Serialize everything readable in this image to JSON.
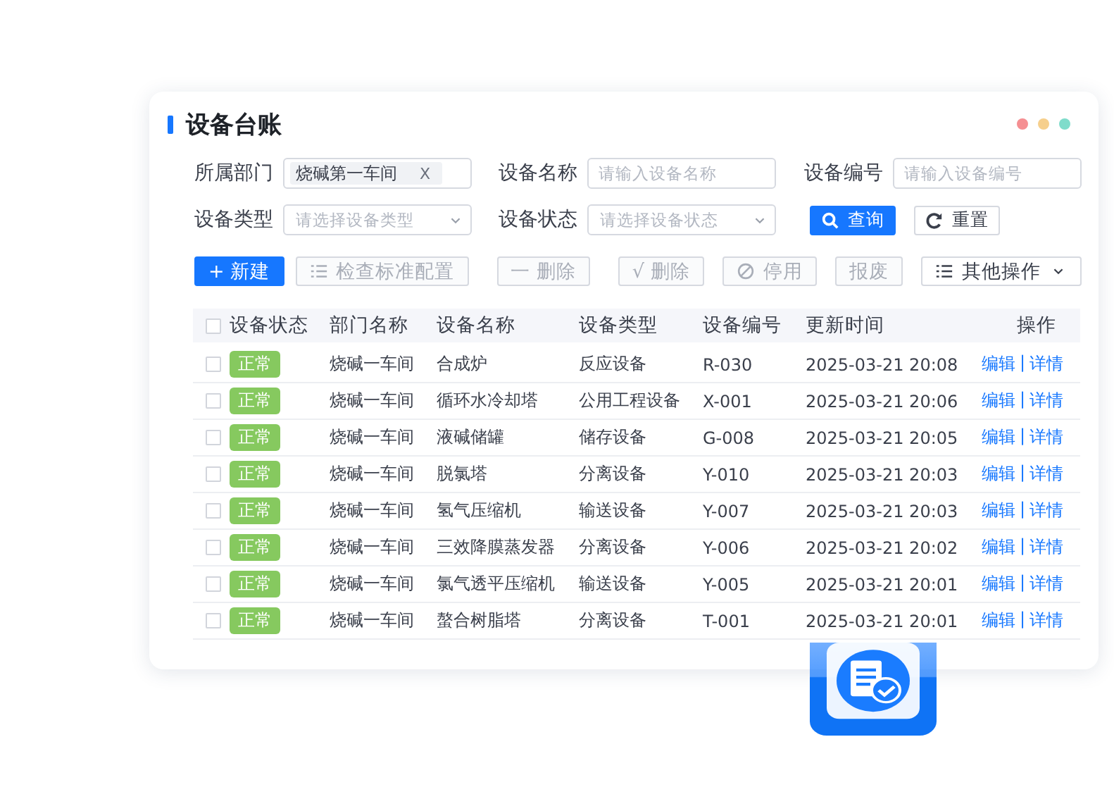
{
  "title": "设备台账",
  "filters": [
    {
      "label": "所属部门",
      "kind": "tag",
      "value": "烧碱第一车间",
      "clear": "X"
    },
    {
      "label": "设备名称",
      "kind": "input",
      "placeholder": "请输入设备名称"
    },
    {
      "label": "设备编号",
      "kind": "input",
      "placeholder": "请输入设备编号"
    },
    {
      "label": "设备类型",
      "kind": "select",
      "placeholder": "请选择设备类型"
    },
    {
      "label": "设备状态",
      "kind": "select",
      "placeholder": "请选择设备状态"
    }
  ],
  "filter_buttons": [
    {
      "label": "查询",
      "kind": "primary"
    },
    {
      "label": "重置",
      "kind": "default"
    }
  ],
  "toolbar": [
    {
      "label": "+ 新建",
      "kind": "primary",
      "disabled": false
    },
    {
      "label": "检查标准配置",
      "kind": "default",
      "disabled": true
    },
    {
      "label": "一 删除",
      "kind": "default",
      "disabled": true
    },
    {
      "label": "√ 删除",
      "kind": "default",
      "disabled": true
    },
    {
      "label": "停用",
      "kind": "default",
      "disabled": true
    },
    {
      "label": "报废",
      "kind": "default",
      "disabled": true
    },
    {
      "label": "其他操作",
      "kind": "menu",
      "disabled": false
    }
  ],
  "table": {
    "header_checked": false,
    "columns": [
      "设备状态",
      "部门名称",
      "设备名称",
      "设备类型",
      "设备编号",
      "更新时间",
      "操作"
    ],
    "rows": [
      {
        "checked": false,
        "status": "正常",
        "dept": "烧碱一车间",
        "name": "合成炉",
        "type": "反应设备",
        "code": "R-030",
        "time": "2025-03-21 20:08",
        "edit": "编辑",
        "sep": "|",
        "detail": "详情"
      },
      {
        "checked": false,
        "status": "正常",
        "dept": "烧碱一车间",
        "name": "循环水冷却塔",
        "type": "公用工程设备",
        "code": "X-001",
        "time": "2025-03-21 20:06",
        "edit": "编辑",
        "sep": "|",
        "detail": "详情"
      },
      {
        "checked": false,
        "status": "正常",
        "dept": "烧碱一车间",
        "name": "液碱储罐",
        "type": "储存设备",
        "code": "G-008",
        "time": "2025-03-21 20:05",
        "edit": "编辑",
        "sep": "|",
        "detail": "详情"
      },
      {
        "checked": false,
        "status": "正常",
        "dept": "烧碱一车间",
        "name": "脱氯塔",
        "type": "分离设备",
        "code": "Y-010",
        "time": "2025-03-21 20:03",
        "edit": "编辑",
        "sep": "|",
        "detail": "详情"
      },
      {
        "checked": false,
        "status": "正常",
        "dept": "烧碱一车间",
        "name": "氢气压缩机",
        "type": "输送设备",
        "code": "Y-007",
        "time": "2025-03-21 20:03",
        "edit": "编辑",
        "sep": "|",
        "detail": "详情"
      },
      {
        "checked": false,
        "status": "正常",
        "dept": "烧碱一车间",
        "name": "三效降膜蒸发器",
        "type": "分离设备",
        "code": "Y-006",
        "time": "2025-03-21 20:02",
        "edit": "编辑",
        "sep": "|",
        "detail": "详情"
      },
      {
        "checked": false,
        "status": "正常",
        "dept": "烧碱一车间",
        "name": "氯气透平压缩机",
        "type": "输送设备",
        "code": "Y-005",
        "time": "2025-03-21 20:01",
        "edit": "编辑",
        "sep": "|",
        "detail": "详情"
      },
      {
        "checked": false,
        "status": "正常",
        "dept": "烧碱一车间",
        "name": "螯合树脂塔",
        "type": "分离设备",
        "code": "T-001",
        "time": "2025-03-21 20:01",
        "edit": "编辑",
        "sep": "|",
        "detail": "详情"
      }
    ]
  }
}
